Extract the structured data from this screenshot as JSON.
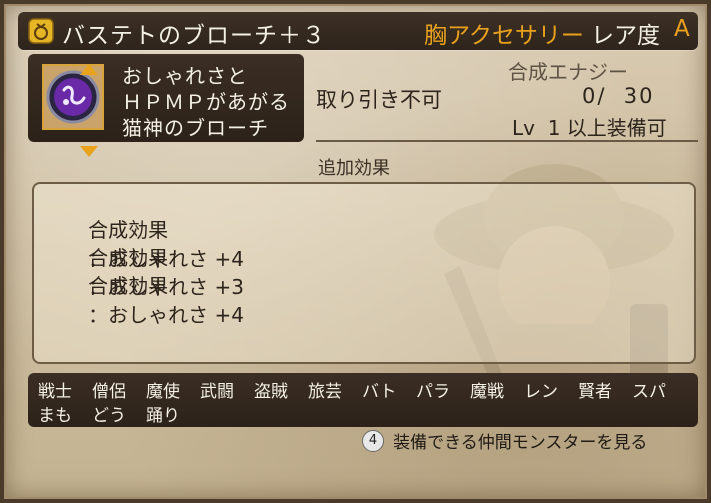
{
  "title": {
    "item_name": "バステトのブローチ＋３",
    "category": "胸アクセサリー",
    "rarity_label": "レア度",
    "rarity_value": "A"
  },
  "item": {
    "description": [
      "おしゃれさと",
      "ＨＰＭＰがあがる",
      "猫神のブローチ"
    ]
  },
  "info": {
    "trade": "取り引き不可",
    "energy_label": "合成エナジー",
    "energy_value": "0/  30",
    "level_req": "Lv  1 以上装備可"
  },
  "effects": {
    "header": "追加効果",
    "rows": [
      {
        "label": "合成効果",
        "value": "：おしゃれさ +4"
      },
      {
        "label": "合成効果",
        "value": "：おしゃれさ +3"
      },
      {
        "label": "合成効果",
        "value": "：おしゃれさ +4"
      }
    ]
  },
  "jobs": {
    "row1": [
      "戦士",
      "僧侶",
      "魔使",
      "武闘",
      "盗賊",
      "旅芸",
      "バト",
      "パラ",
      "魔戦",
      "レン",
      "賢者",
      "スパ"
    ],
    "row2": [
      "まも",
      "どう",
      "踊り"
    ]
  },
  "footer": {
    "button": "4",
    "text": "装備できる仲間モンスターを見る"
  },
  "colors": {
    "accent": "#e9a11d",
    "panel_dark": "#2e241b",
    "parchment": "#cdbd9f"
  },
  "icons": {
    "title_icon": "accessory-icon",
    "item_icon": "bastet-brooch-icon"
  }
}
